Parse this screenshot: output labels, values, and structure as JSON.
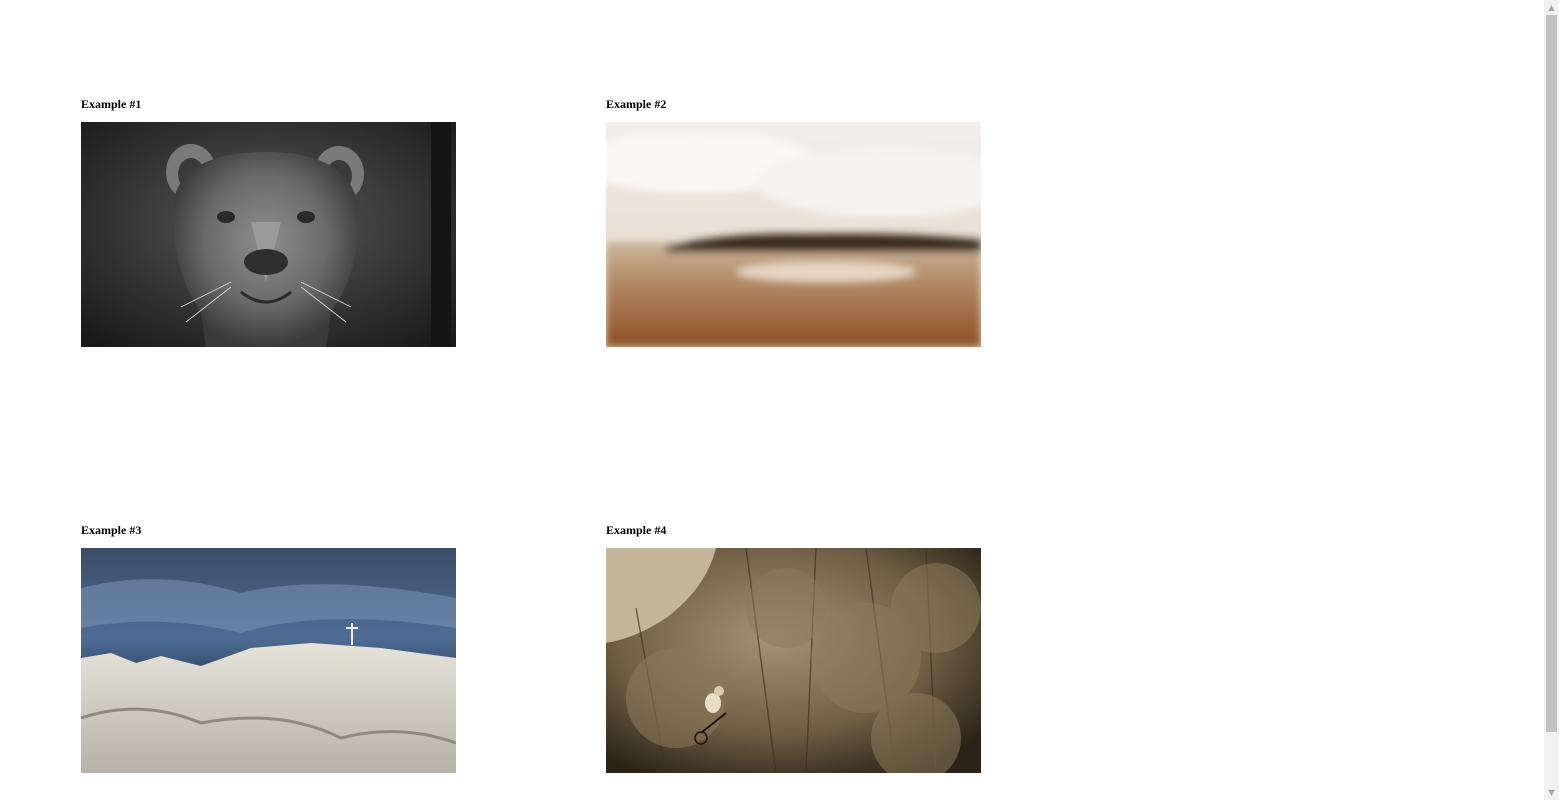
{
  "examples": [
    {
      "title": "Example #1",
      "image": "lioness-grayscale-image"
    },
    {
      "title": "Example #2",
      "image": "lake-sepia-blur-image"
    },
    {
      "title": "Example #3",
      "image": "mountain-summit-inverted-image"
    },
    {
      "title": "Example #4",
      "image": "forest-biker-sepia-image"
    }
  ],
  "scrollbar": {
    "up_icon": "▲",
    "down_icon": "▼"
  }
}
